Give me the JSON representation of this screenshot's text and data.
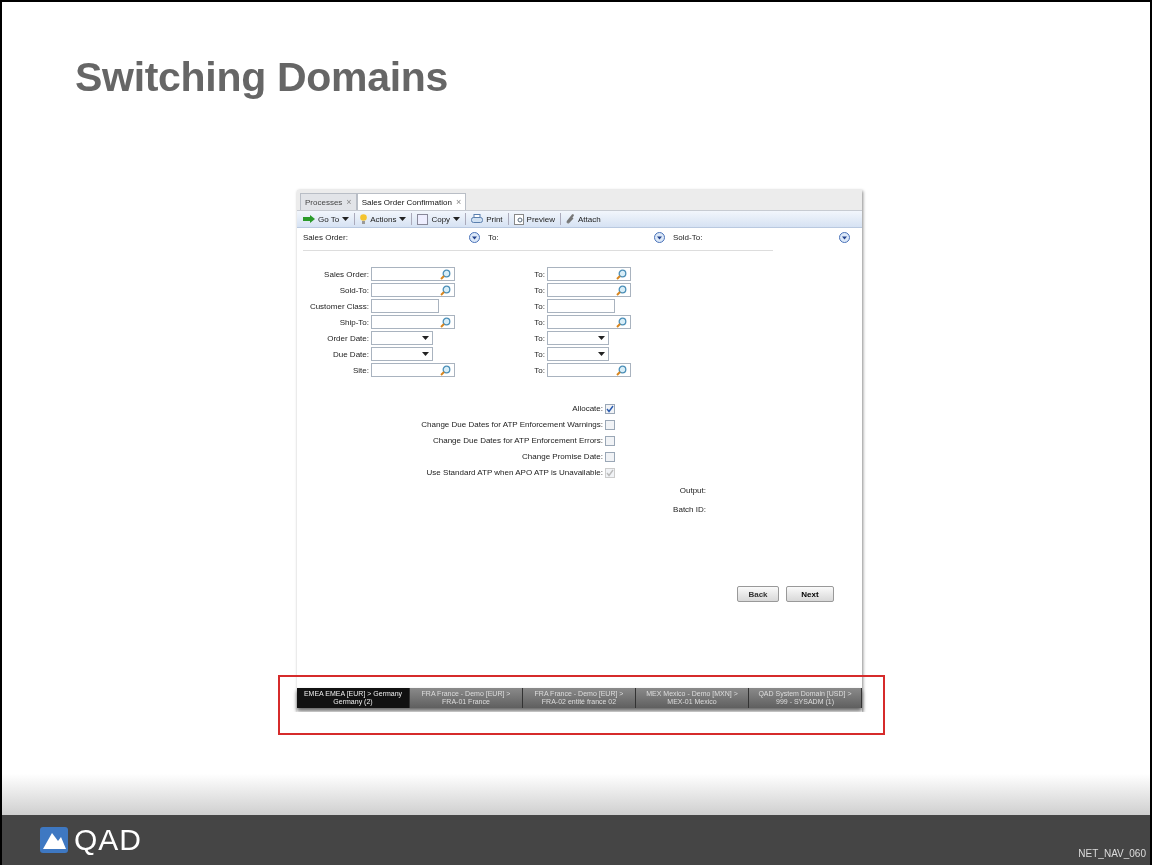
{
  "slide": {
    "title": "Switching Domains",
    "footer_code": "NET_NAV_060",
    "logo_text": "QAD"
  },
  "tabs": [
    {
      "label": "Processes",
      "close": "×",
      "selected": false
    },
    {
      "label": "Sales Order Confirmation",
      "close": "×",
      "selected": true
    }
  ],
  "toolbar": [
    {
      "kind": "goto",
      "label": "Go To",
      "menu": true
    },
    {
      "kind": "actions",
      "label": "Actions",
      "menu": true
    },
    {
      "kind": "copy",
      "label": "Copy",
      "menu": true
    },
    {
      "kind": "print",
      "label": "Print",
      "menu": false
    },
    {
      "kind": "preview",
      "label": "Preview",
      "menu": false
    },
    {
      "kind": "attach",
      "label": "Attach",
      "menu": false
    }
  ],
  "header": [
    "Sales Order:",
    "To:",
    "Sold-To:"
  ],
  "fields": [
    {
      "label": "Sales Order:",
      "kind": "lookup",
      "to_label": "To:"
    },
    {
      "label": "Sold-To:",
      "kind": "lookup",
      "to_label": "To:"
    },
    {
      "label": "Customer Class:",
      "kind": "text",
      "to_label": "To:"
    },
    {
      "label": "Ship-To:",
      "kind": "lookup",
      "to_label": "To:"
    },
    {
      "label": "Order Date:",
      "kind": "date",
      "to_label": "To:"
    },
    {
      "label": "Due Date:",
      "kind": "date",
      "to_label": "To:"
    },
    {
      "label": "Site:",
      "kind": "lookup",
      "to_label": "To:"
    }
  ],
  "checks": [
    {
      "label": "Allocate:",
      "checked": true,
      "disabled": false
    },
    {
      "label": "Change Due Dates for ATP Enforcement Warnings:",
      "checked": false,
      "disabled": false
    },
    {
      "label": "Change Due Dates for ATP Enforcement Errors:",
      "checked": false,
      "disabled": false
    },
    {
      "label": "Change Promise Date:",
      "checked": false,
      "disabled": false
    },
    {
      "label": "Use Standard ATP when APO ATP is Unavailable:",
      "checked": true,
      "disabled": true
    }
  ],
  "output_labels": [
    "Output:",
    "Batch ID:"
  ],
  "buttons": [
    "Back",
    "Next"
  ],
  "domains": [
    {
      "line_1": "EMEA EMEA [EUR] > Germany",
      "line_2": "Germany (2)",
      "selected": true
    },
    {
      "line_1": "FRA France - Demo [EUR] >",
      "line_2": "FRA-01 France",
      "selected": false
    },
    {
      "line_1": "FRA France - Demo [EUR] >",
      "line_2": "FRA-02 entité france 02",
      "selected": false
    },
    {
      "line_1": "MEX Mexico - Demo [MXN] >",
      "line_2": "MEX-01 Mexico",
      "selected": false
    },
    {
      "line_1": "QAD System Domain [USD] >",
      "line_2": "999 - SYSADM (1)",
      "selected": false
    }
  ]
}
